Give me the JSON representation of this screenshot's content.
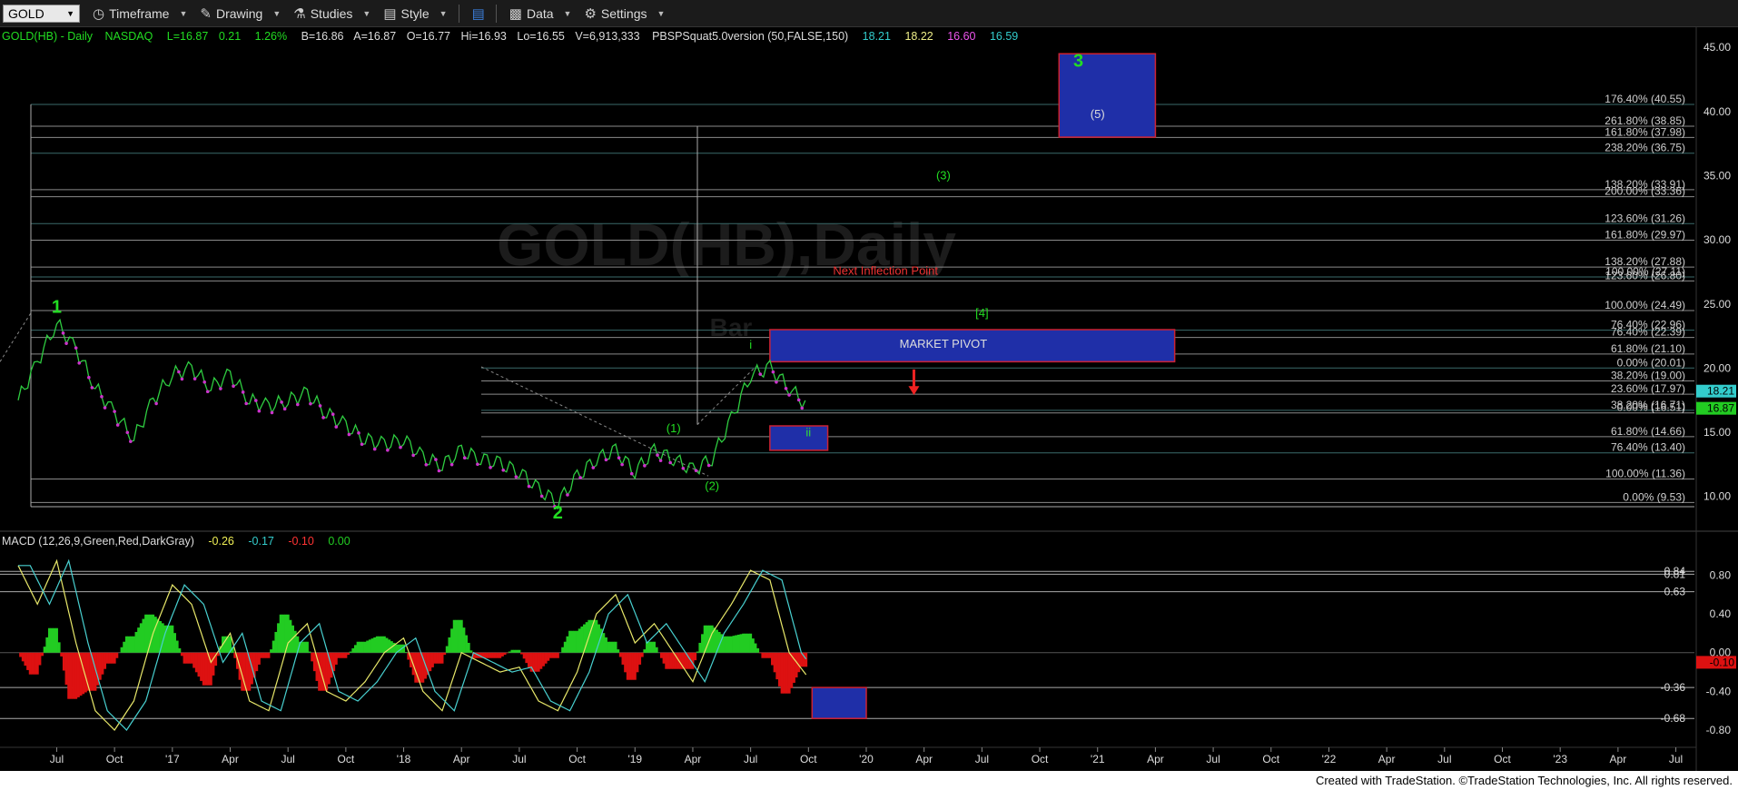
{
  "toolbar": {
    "symbol": "GOLD",
    "timeframe": "Timeframe",
    "drawing": "Drawing",
    "studies": "Studies",
    "style": "Style",
    "data": "Data",
    "settings": "Settings"
  },
  "header": {
    "symbol_line": "GOLD(HB) - Daily",
    "exchange": "NASDAQ",
    "last": "L=16.87",
    "change": "0.21",
    "change_pct": "1.26%",
    "bid": "B=16.86",
    "ask": "A=16.87",
    "open": "O=16.77",
    "high": "Hi=16.93",
    "low": "Lo=16.55",
    "volume": "V=6,913,333",
    "study": "PBSPSquat5.0version (50,FALSE,150)",
    "study_v1": "18.21",
    "study_v2": "18.22",
    "study_v3": "16.60",
    "study_v4": "16.59"
  },
  "watermark": "GOLD(HB),Daily",
  "watermark_sub": "Bar",
  "macd_header": {
    "label": "MACD (12,26,9,Green,Red,DarkGray)",
    "v1": "-0.26",
    "v2": "-0.17",
    "v3": "-0.10",
    "v4": "0.00"
  },
  "footer": "Created with TradeStation. ©TradeStation Technologies, Inc. All rights reserved.",
  "colors": {
    "up": "#2ecc40",
    "down": "#cc33cc",
    "pivot": "#1f2fa8",
    "fib": "#aaaaaa",
    "wave": "#22dd22",
    "macd_pos": "#22cc22",
    "macd_neg": "#dd1111"
  },
  "chart_data": [
    {
      "type": "line",
      "title": "GOLD(HB) - Daily",
      "x_ticks": [
        "Jul",
        "Oct",
        "'17",
        "Apr",
        "Jul",
        "Oct",
        "'18",
        "Apr",
        "Jul",
        "Oct",
        "'19",
        "Apr",
        "Jul",
        "Oct",
        "'20",
        "Apr",
        "Jul",
        "Oct",
        "'21",
        "Apr",
        "Jul",
        "Oct",
        "'22",
        "Apr",
        "Jul",
        "Oct",
        "'23",
        "Apr",
        "Jul"
      ],
      "x_range": [
        "2016-05",
        "2023-09"
      ],
      "ylim": [
        8,
        46
      ],
      "y_ticks": [
        "10.00",
        "15.00",
        "20.00",
        "25.00",
        "30.00",
        "35.00",
        "40.00",
        "45.00"
      ],
      "series": [
        {
          "x": [
            "2016-05",
            "2016-06",
            "2016-07",
            "2016-08",
            "2016-09",
            "2016-10",
            "2016-11",
            "2016-12",
            "2017-01",
            "2017-02",
            "2017-03",
            "2017-04",
            "2017-05",
            "2017-06",
            "2017-07",
            "2017-08",
            "2017-09",
            "2017-10",
            "2017-11",
            "2017-12",
            "2018-01",
            "2018-02",
            "2018-03",
            "2018-04",
            "2018-05",
            "2018-06",
            "2018-07",
            "2018-08",
            "2018-09",
            "2018-10",
            "2018-11",
            "2018-12",
            "2019-01",
            "2019-02",
            "2019-03",
            "2019-04",
            "2019-05",
            "2019-06",
            "2019-07",
            "2019-08",
            "2019-09",
            "2019-10"
          ],
          "values": [
            17.5,
            20.5,
            23.5,
            21.5,
            18.5,
            16.5,
            14.5,
            17.5,
            19.5,
            20.0,
            18.5,
            19.5,
            17.5,
            17.0,
            17.5,
            18.0,
            16.5,
            15.5,
            14.5,
            14.0,
            14.5,
            13.0,
            12.5,
            13.5,
            13.0,
            12.5,
            12.0,
            10.5,
            9.6,
            11.5,
            13.0,
            13.5,
            12.0,
            13.5,
            13.0,
            12.0,
            13.0,
            16.0,
            19.5,
            20.0,
            18.5,
            16.9
          ]
        }
      ],
      "levels": [
        {
          "label": "176.40% (40.55)",
          "value": 40.55
        },
        {
          "label": "261.80% (38.85)",
          "value": 38.85
        },
        {
          "label": "161.80% (37.98)",
          "value": 37.98
        },
        {
          "label": "238.20% (36.75)",
          "value": 36.75
        },
        {
          "label": "138.20% (33.91)",
          "value": 33.91
        },
        {
          "label": "200.00% (33.36)",
          "value": 33.36
        },
        {
          "label": "123.60% (31.26)",
          "value": 31.26
        },
        {
          "label": "161.80% (29.97)",
          "value": 29.97
        },
        {
          "label": "138.20% (27.88)",
          "value": 27.88
        },
        {
          "label": "100.00% (27.11)",
          "value": 27.11
        },
        {
          "label": "123.60% (26.80)",
          "value": 26.8
        },
        {
          "label": "100.00% (24.49)",
          "value": 24.49
        },
        {
          "label": "76.40% (22.96)",
          "value": 22.96
        },
        {
          "label": "76.40% (22.39)",
          "value": 22.39
        },
        {
          "label": "61.80% (21.10)",
          "value": 21.1
        },
        {
          "label": "0.00% (20.01)",
          "value": 20.01
        },
        {
          "label": "38.20% (19.00)",
          "value": 19.0
        },
        {
          "label": "23.60% (17.97)",
          "value": 17.97
        },
        {
          "label": "38.20% (16.71)",
          "value": 16.71
        },
        {
          "label": "0.00% (16.51)",
          "value": 16.51
        },
        {
          "label": "61.80% (14.66)",
          "value": 14.66
        },
        {
          "label": "76.40% (13.40)",
          "value": 13.4
        },
        {
          "label": "100.00% (11.36)",
          "value": 11.36
        },
        {
          "label": "0.00% (9.53)",
          "value": 9.53
        }
      ],
      "price_markers": [
        {
          "label": "18.21",
          "value": 18.21,
          "color": "#33cccc"
        },
        {
          "label": "16.87",
          "value": 16.87,
          "color": "#22cc22"
        }
      ],
      "annotations": [
        {
          "label": "1",
          "x": "2016-07",
          "value": 24.3,
          "big": true
        },
        {
          "label": "2",
          "x": "2018-09",
          "value": 8.3,
          "big": true
        },
        {
          "label": "3",
          "x": "2020-12",
          "value": 43.5,
          "big": true
        },
        {
          "label": "(1)",
          "x": "2019-03",
          "value": 15.0
        },
        {
          "label": "(2)",
          "x": "2019-05",
          "value": 10.5
        },
        {
          "label": "(3)",
          "x": "2020-05",
          "value": 34.7
        },
        {
          "label": "[4]",
          "x": "2020-07",
          "value": 24.0
        },
        {
          "label": "(5)",
          "x": "2021-01",
          "value": 39.5
        },
        {
          "label": "i",
          "x": "2019-07",
          "value": 21.5
        },
        {
          "label": "ii",
          "x": "2019-10",
          "value": 14.7
        },
        {
          "label": "MARKET PIVOT",
          "x": "2020-05",
          "value": 21.6
        },
        {
          "label": "Next Inflection Point",
          "x": "2020-02",
          "value": 27.3
        }
      ],
      "boxes": [
        {
          "label": "MARKET PIVOT",
          "x0": "2019-08",
          "x1": "2021-05",
          "y0": 20.5,
          "y1": 23.0
        },
        {
          "label": "3",
          "x0": "2020-11",
          "x1": "2021-04",
          "y0": 38.0,
          "y1": 44.5
        },
        {
          "label": "ii",
          "x0": "2019-08",
          "x1": "2019-11",
          "y0": 13.6,
          "y1": 15.5
        }
      ]
    },
    {
      "type": "bar",
      "title": "MACD (12,26,9,Green,Red,DarkGray)",
      "ylim": [
        -0.95,
        1.02
      ],
      "y_ticks": [
        "0.80",
        "0.40",
        "0.00",
        "-0.40",
        "-0.80"
      ],
      "levels": [
        {
          "label": "0.84",
          "value": 0.84
        },
        {
          "label": "0.81",
          "value": 0.81
        },
        {
          "label": "0.63",
          "value": 0.63
        },
        {
          "label": "-0.36",
          "value": -0.36
        },
        {
          "label": "-0.68",
          "value": -0.68
        }
      ],
      "price_markers": [
        {
          "label": "-0.10",
          "value": -0.1,
          "color": "#dd1111"
        }
      ],
      "series": [
        {
          "name": "MACD",
          "x": [
            "2016-05",
            "2016-06",
            "2016-07",
            "2016-08",
            "2016-09",
            "2016-10",
            "2016-11",
            "2016-12",
            "2017-01",
            "2017-02",
            "2017-03",
            "2017-04",
            "2017-05",
            "2017-06",
            "2017-07",
            "2017-08",
            "2017-09",
            "2017-10",
            "2017-11",
            "2017-12",
            "2018-01",
            "2018-02",
            "2018-03",
            "2018-04",
            "2018-05",
            "2018-06",
            "2018-07",
            "2018-08",
            "2018-09",
            "2018-10",
            "2018-11",
            "2018-12",
            "2019-01",
            "2019-02",
            "2019-03",
            "2019-04",
            "2019-05",
            "2019-06",
            "2019-07",
            "2019-08",
            "2019-09",
            "2019-10"
          ],
          "values": [
            0.9,
            0.5,
            0.95,
            0.1,
            -0.6,
            -0.8,
            -0.5,
            0.2,
            0.7,
            0.5,
            -0.1,
            0.2,
            -0.5,
            -0.6,
            0.1,
            0.3,
            -0.4,
            -0.5,
            -0.3,
            0.0,
            0.15,
            -0.4,
            -0.6,
            0.0,
            -0.1,
            -0.2,
            -0.15,
            -0.5,
            -0.6,
            -0.2,
            0.4,
            0.6,
            0.1,
            0.3,
            0.0,
            -0.3,
            0.2,
            0.5,
            0.85,
            0.75,
            0.0,
            -0.26
          ]
        }
      ]
    }
  ]
}
